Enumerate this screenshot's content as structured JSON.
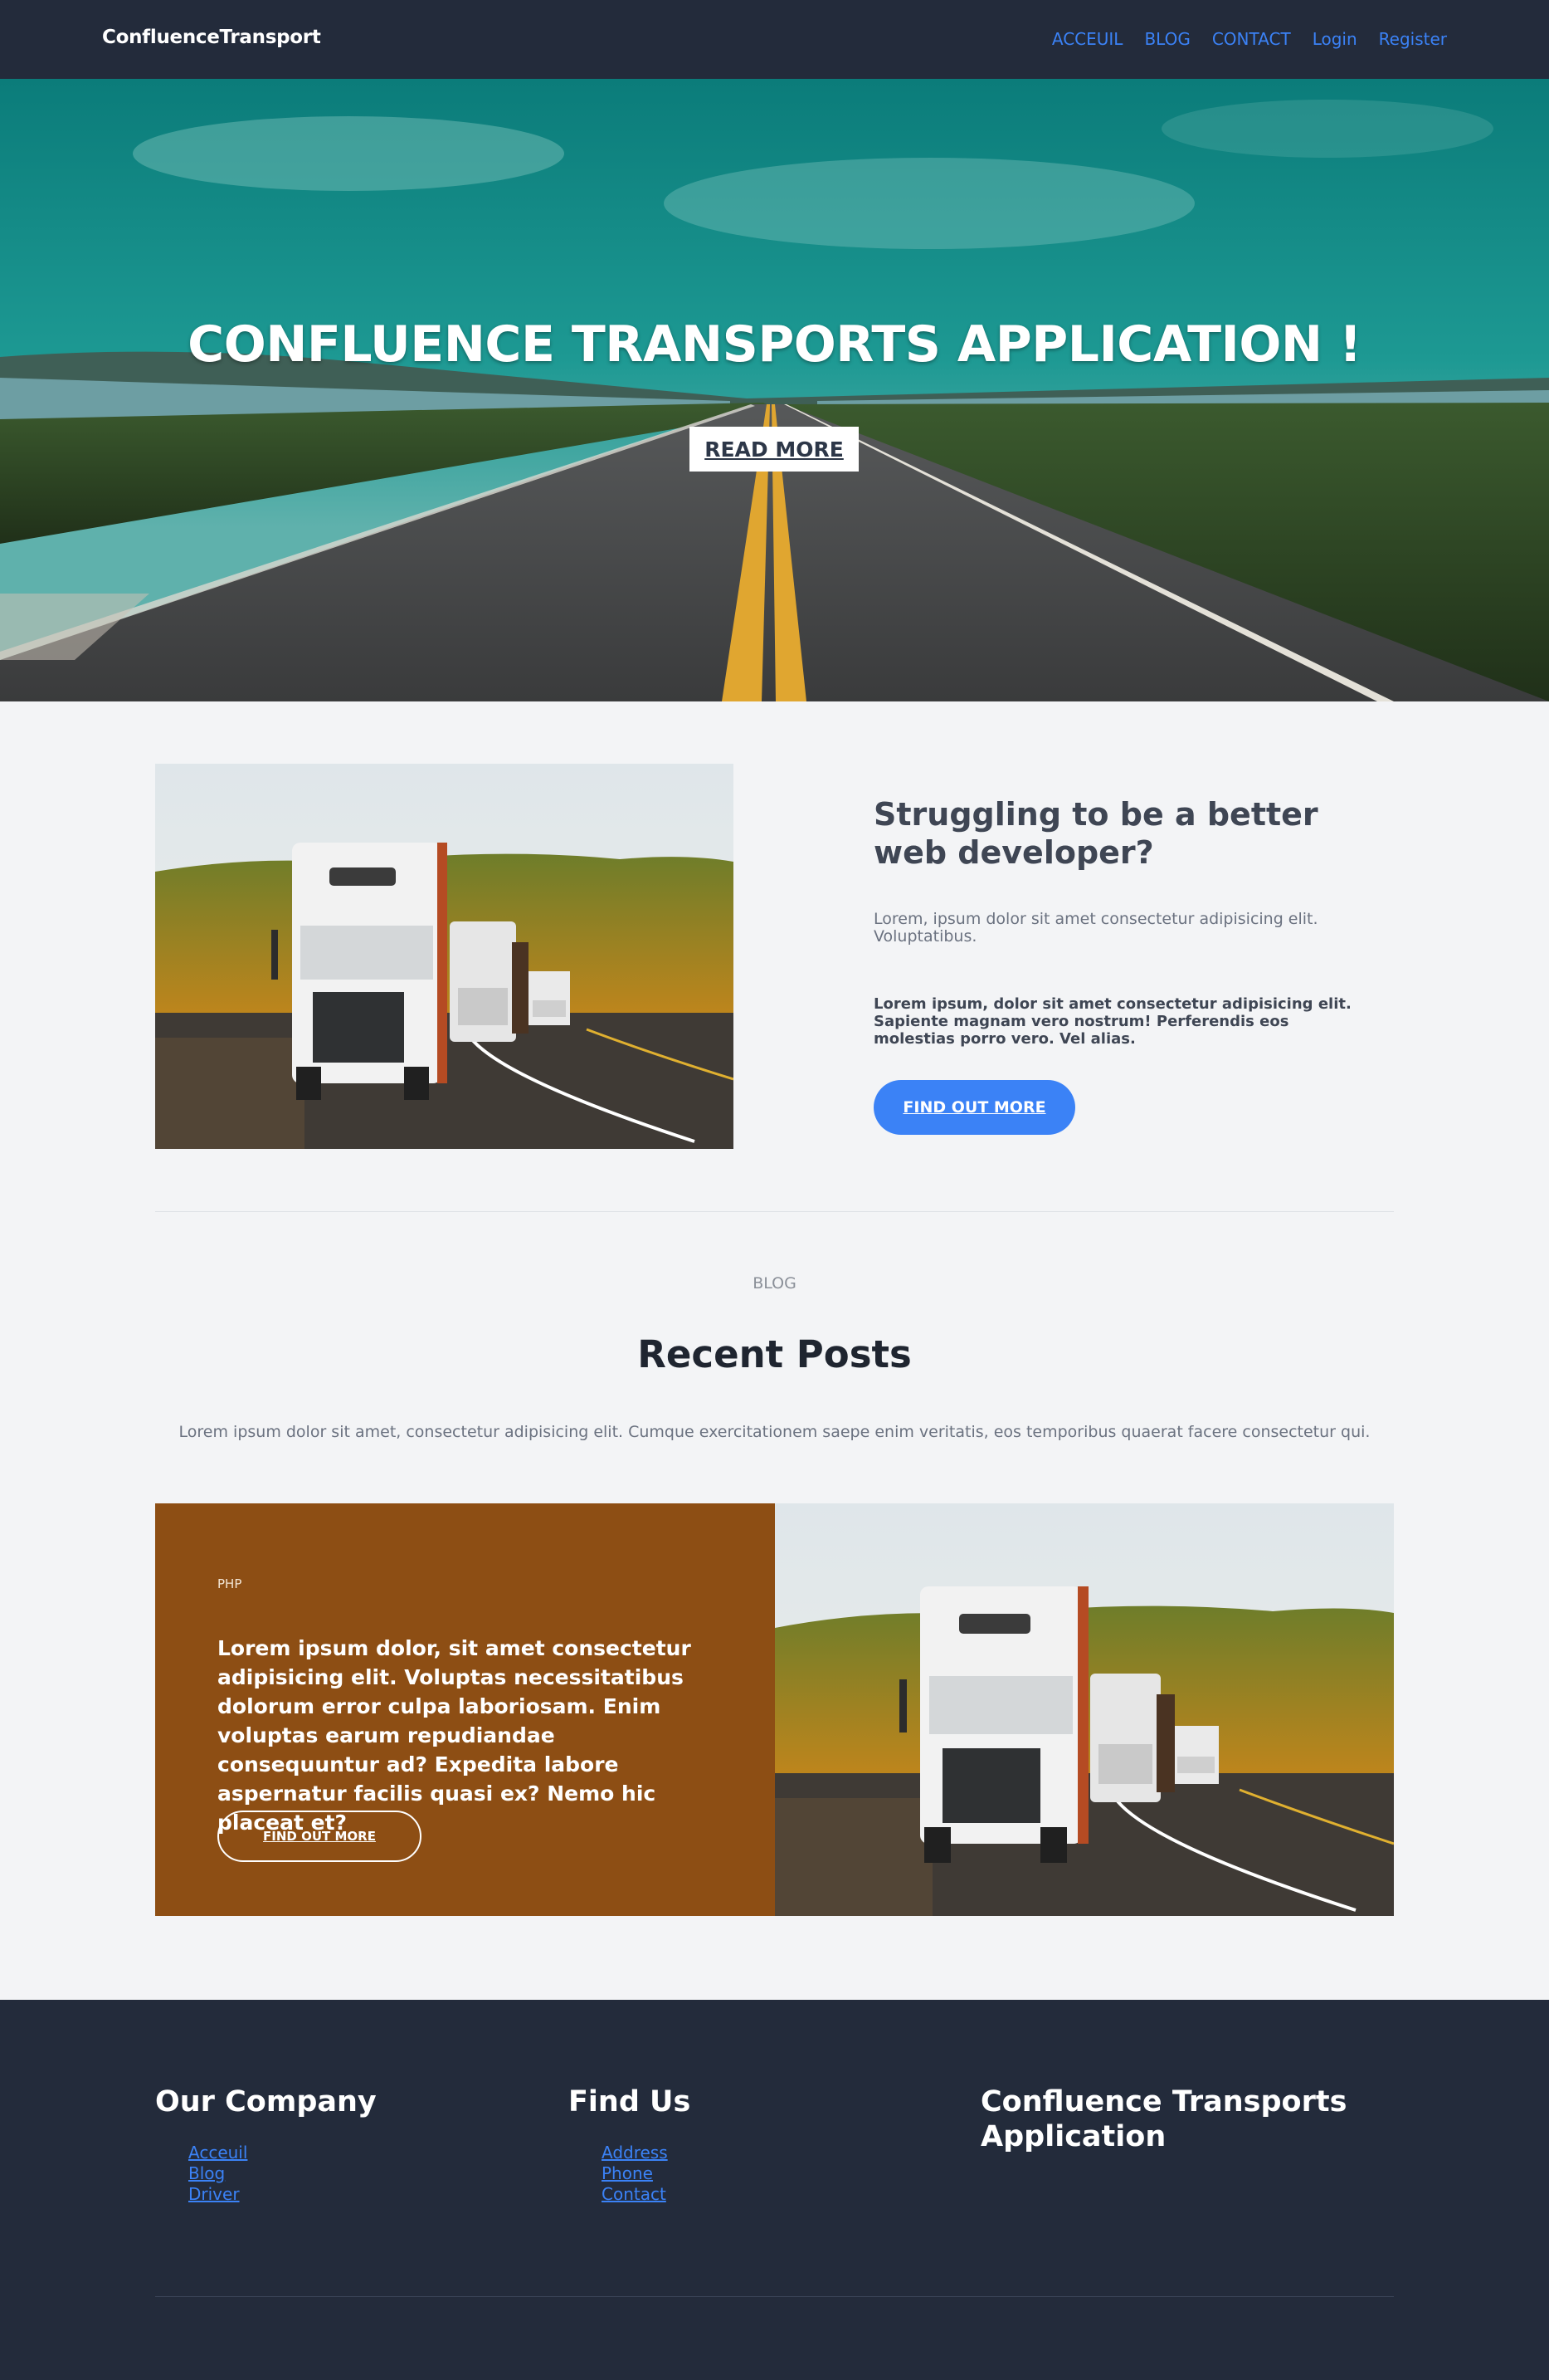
{
  "navbar": {
    "brand": "ConfluenceTransport",
    "links": [
      "ACCEUIL",
      "BLOG",
      "CONTACT",
      "Login",
      "Register"
    ]
  },
  "hero": {
    "title": "CONFLUENCE TRANSPORTS APPLICATION !",
    "button_label": "READ MORE"
  },
  "feature": {
    "title": "Struggling to be a better web developer?",
    "text": "Lorem, ipsum dolor sit amet consectetur adipisicing elit. Voluptatibus.",
    "bold_text": "Lorem ipsum, dolor sit amet consectetur adipisicing elit. Sapiente magnam vero nostrum! Perferendis eos molestias porro vero. Vel alias.",
    "button_label": "FIND OUT MORE"
  },
  "blog": {
    "eyebrow": "BLOG",
    "title": "Recent Posts",
    "description": "Lorem ipsum dolor sit amet, consectetur adipisicing elit. Cumque exercitationem saepe enim veritatis, eos temporibus quaerat facere consectetur qui.",
    "post": {
      "tag": "PHP",
      "title": "Lorem ipsum dolor, sit amet consectetur adipisicing elit. Voluptas necessitatibus dolorum error culpa laboriosam. Enim voluptas earum repudiandae consequuntur ad? Expedita labore aspernatur facilis quasi ex? Nemo hic placeat et?",
      "button_label": "FIND OUT MORE"
    }
  },
  "footer": {
    "columns": [
      {
        "heading": "Our Company",
        "links": [
          "Acceuil",
          "Blog",
          "Driver"
        ]
      },
      {
        "heading": "Find Us",
        "links": [
          "Address",
          "Phone",
          "Contact"
        ]
      },
      {
        "heading": "Confluence Transports Application",
        "links": []
      }
    ]
  },
  "colors": {
    "navbar_bg": "#232b3b",
    "link_blue": "#3b82f6",
    "post_card_bg": "#8d4e14",
    "page_bg": "#f3f4f6"
  }
}
